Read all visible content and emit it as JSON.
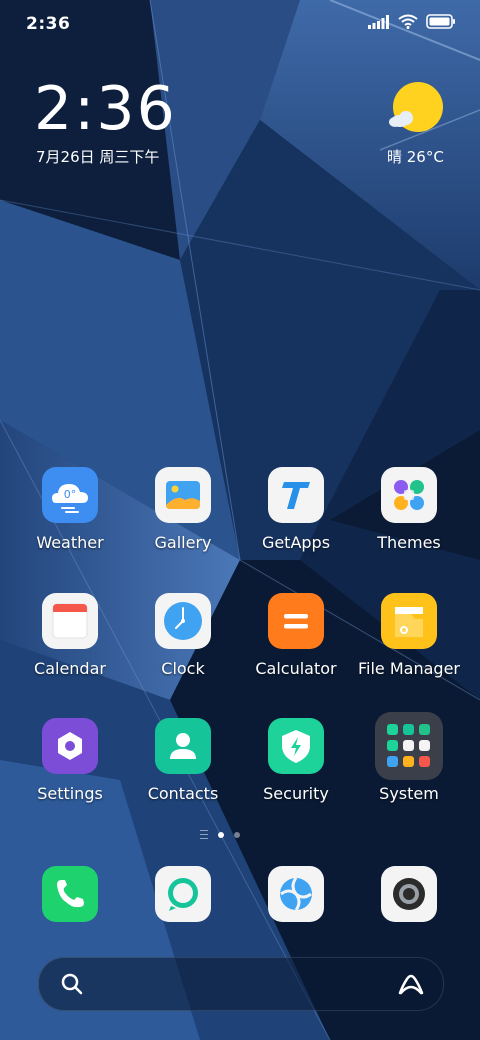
{
  "status_bar": {
    "time": "2:36",
    "icons": [
      "signal-icon",
      "wifi-icon",
      "battery-icon"
    ]
  },
  "widget": {
    "time": "2:36",
    "date": "7月26日 周三下午",
    "weather": "晴 26°C",
    "weather_icon": "sun-cloud-icon"
  },
  "apps": [
    {
      "label": "Weather",
      "icon": "weather-icon",
      "color": "#3d8ef0"
    },
    {
      "label": "Gallery",
      "icon": "gallery-icon",
      "color": "#f4f4f4"
    },
    {
      "label": "GetApps",
      "icon": "getapps-icon",
      "color": "#f4f4f4"
    },
    {
      "label": "Themes",
      "icon": "themes-icon",
      "color": "#f4f4f4"
    },
    {
      "label": "Calendar",
      "icon": "calendar-icon",
      "color": "#f4f4f4"
    },
    {
      "label": "Clock",
      "icon": "clock-icon",
      "color": "#f4f4f4"
    },
    {
      "label": "Calculator",
      "icon": "calculator-icon",
      "color": "#ff7b1c"
    },
    {
      "label": "File Manager",
      "icon": "folder-icon",
      "color": "#ffc21a"
    },
    {
      "label": "Settings",
      "icon": "settings-icon",
      "color": "#7c4dd6"
    },
    {
      "label": "Contacts",
      "icon": "contacts-icon",
      "color": "#16c49a"
    },
    {
      "label": "Security",
      "icon": "security-icon",
      "color": "#1ed39a"
    },
    {
      "label": "System",
      "icon": "folder-grid-icon",
      "color": "#3a3f4a"
    }
  ],
  "dock": [
    {
      "name": "phone",
      "icon": "phone-icon"
    },
    {
      "name": "messaging",
      "icon": "message-icon"
    },
    {
      "name": "browser",
      "icon": "browser-icon"
    },
    {
      "name": "camera",
      "icon": "camera-icon"
    }
  ],
  "page_indicator": {
    "pages": 2,
    "current": 1
  },
  "search": {
    "icons": [
      "search-icon",
      "assistant-icon"
    ]
  }
}
